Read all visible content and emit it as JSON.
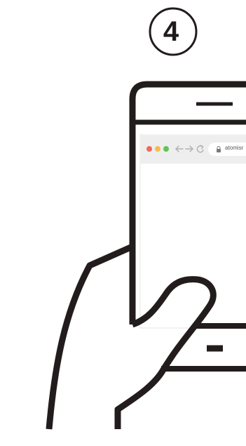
{
  "step": {
    "number": "4"
  },
  "browser": {
    "url_text": "atomisr",
    "traffic_lights": {
      "close": "#ee6a5f",
      "minimize": "#f5bd4f",
      "maximize": "#61c454"
    },
    "nav_icons": [
      "back-arrow-icon",
      "forward-arrow-icon",
      "reload-icon",
      "lock-icon"
    ]
  },
  "colors": {
    "outline": "#221c1d",
    "background": "#ffffff",
    "browser_bar": "#eeeeee",
    "url_field": "#ffffff",
    "icon_gray": "#b0b0b0"
  }
}
